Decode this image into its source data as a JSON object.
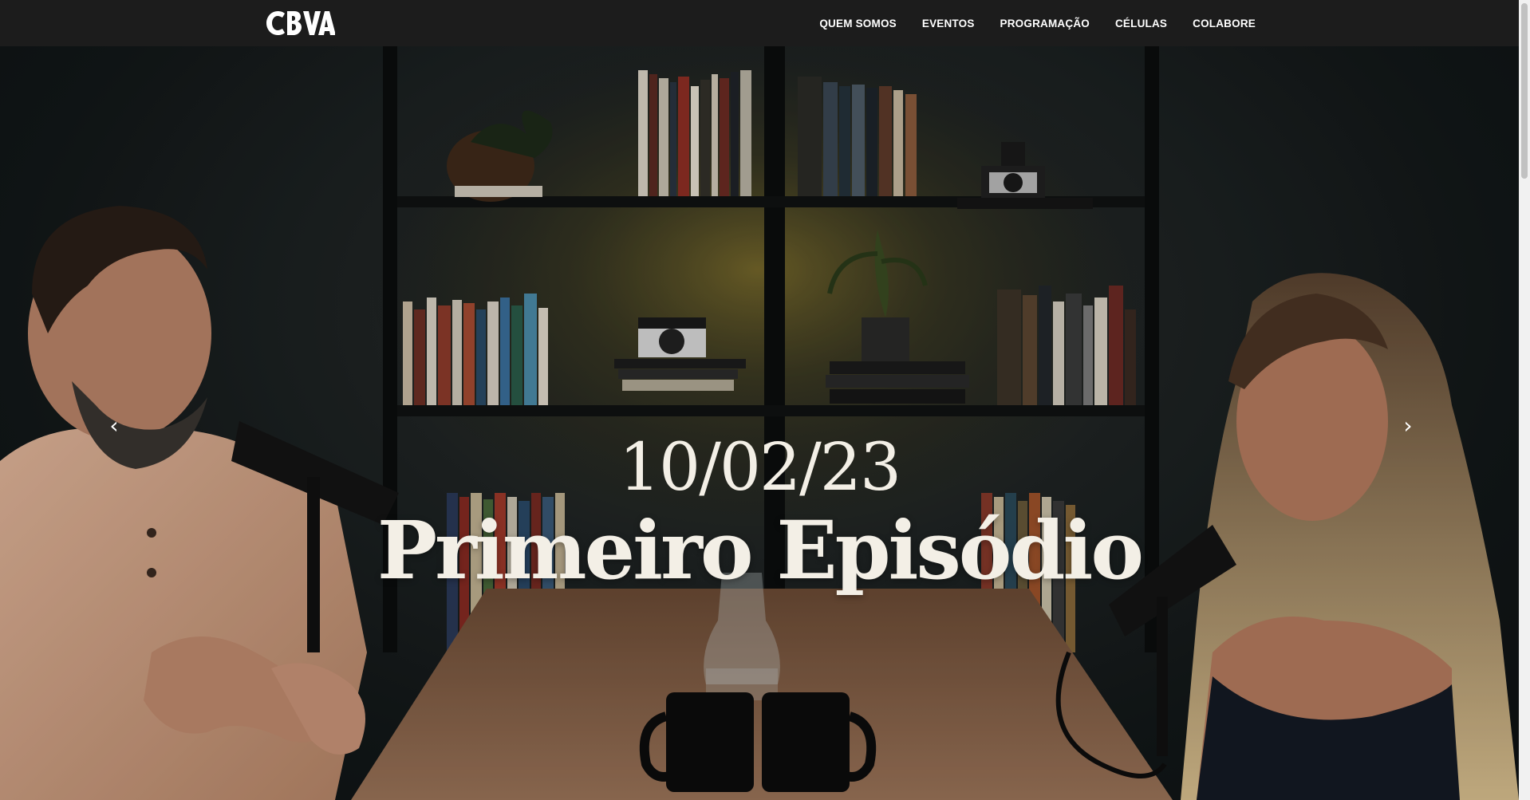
{
  "brand": {
    "logo_text": "CBVA"
  },
  "nav": {
    "items": [
      {
        "label": "QUEM SOMOS"
      },
      {
        "label": "EVENTOS"
      },
      {
        "label": "PROGRAMAÇÃO"
      },
      {
        "label": "CÉLULAS"
      },
      {
        "label": "COLABORE"
      }
    ]
  },
  "hero": {
    "date": "10/02/23",
    "title": "Primeiro Episódio",
    "prev_icon": "chevron-left-icon",
    "next_icon": "chevron-right-icon",
    "prev_glyph": "‹",
    "next_glyph": "›"
  },
  "colors": {
    "navbar_bg": "#1c1c1c",
    "text_light": "#f3efe6",
    "wall": "#121718"
  }
}
